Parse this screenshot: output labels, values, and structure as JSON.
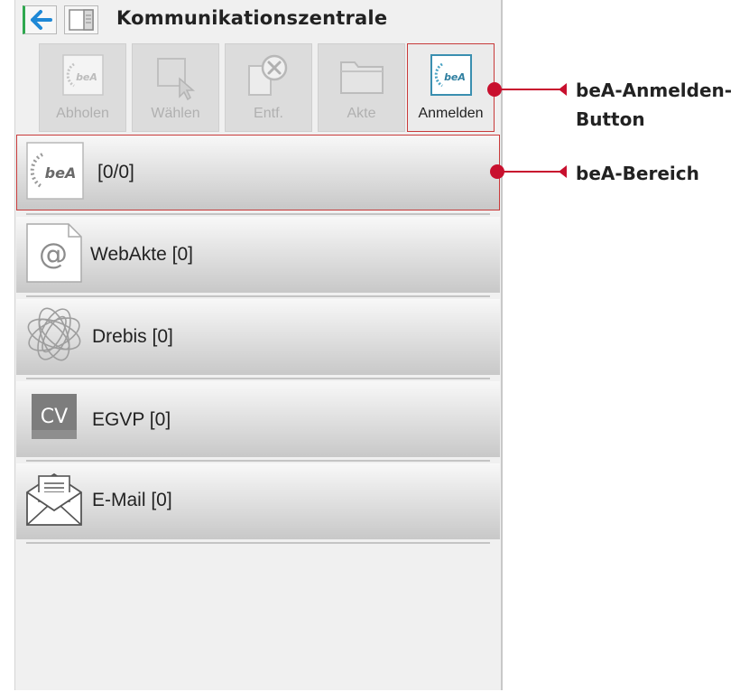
{
  "window": {
    "title": "Kommunikationszentrale"
  },
  "toolbar": {
    "buttons": [
      {
        "label": "Abholen",
        "icon": "bea-logo-icon",
        "state": "disabled"
      },
      {
        "label": "Wählen",
        "icon": "select-cursor-icon",
        "state": "disabled"
      },
      {
        "label": "Entf.",
        "icon": "delete-icon",
        "state": "disabled"
      },
      {
        "label": "Akte",
        "icon": "folder-icon",
        "state": "disabled"
      },
      {
        "label": "Anmelden",
        "icon": "bea-logo-icon",
        "state": "highlighted"
      }
    ]
  },
  "list": {
    "items": [
      {
        "label": "[0/0]",
        "icon": "bea-logo-icon",
        "selected": true
      },
      {
        "label": "WebAkte [0]",
        "icon": "at-sign-icon"
      },
      {
        "label": "Drebis [0]",
        "icon": "drebis-globe-icon"
      },
      {
        "label": "EGVP [0]",
        "icon": "cv-icon",
        "icon_text": "CV"
      },
      {
        "label": "E-Mail [0]",
        "icon": "envelope-icon"
      }
    ]
  },
  "bea_logo_text": "beA",
  "at_symbol": "@",
  "annotations": [
    {
      "line1": "beA-Anmelden-",
      "line2": "Button"
    },
    {
      "line1": "beA-Bereich"
    }
  ],
  "colors": {
    "highlight": "#c83a3a",
    "callout": "#c8102e",
    "back_arrow": "#1e88d6",
    "bea_teal": "#3a8fb0"
  }
}
